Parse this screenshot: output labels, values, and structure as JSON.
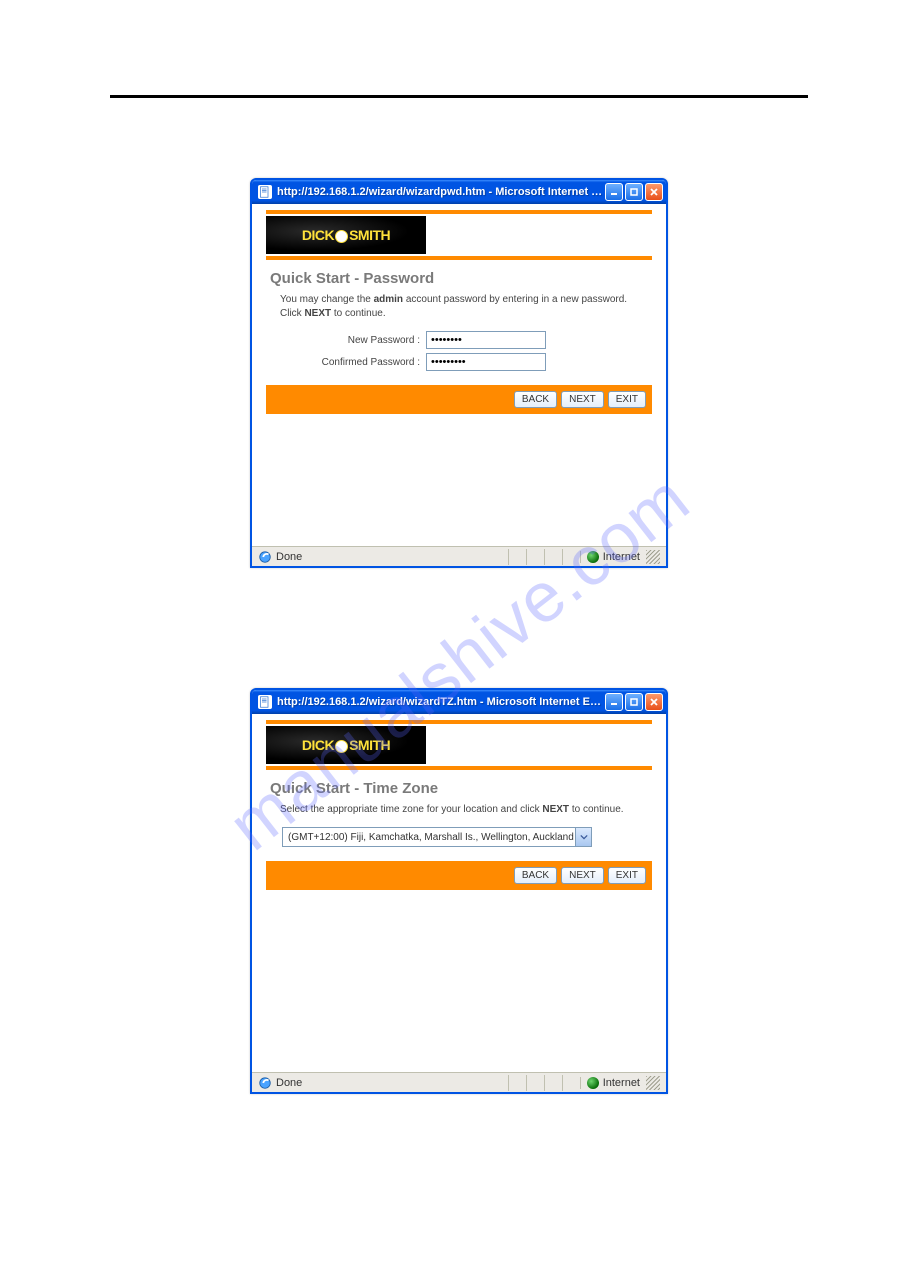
{
  "watermark": "manualshive.com",
  "window1": {
    "title": "http://192.168.1.2/wizard/wizardpwd.htm - Microsoft Internet Ex...",
    "logo": {
      "left": "DICK",
      "right": "SMITH"
    },
    "heading": "Quick Start - Password",
    "instr_pre": "You may change the ",
    "instr_b": "admin",
    "instr_mid": " account password by entering in a new password. Click ",
    "instr_b2": "NEXT",
    "instr_post": " to continue.",
    "label_new": "New Password :",
    "label_conf": "Confirmed Password :",
    "value_new": "••••••••",
    "value_conf": "•••••••••",
    "btn_back": "BACK",
    "btn_next": "NEXT",
    "btn_exit": "EXIT",
    "status_done": "Done",
    "status_zone": "Internet"
  },
  "window2": {
    "title": "http://192.168.1.2/wizard/wizardTZ.htm - Microsoft Internet Expl...",
    "logo": {
      "left": "DICK",
      "right": "SMITH"
    },
    "heading": "Quick Start - Time Zone",
    "instr_pre": "Select the appropriate time zone for your location and click ",
    "instr_b": "NEXT",
    "instr_post": " to continue.",
    "tz_value": "(GMT+12:00) Fiji, Kamchatka, Marshall Is., Wellington, Auckland",
    "btn_back": "BACK",
    "btn_next": "NEXT",
    "btn_exit": "EXIT",
    "status_done": "Done",
    "status_zone": "Internet"
  }
}
